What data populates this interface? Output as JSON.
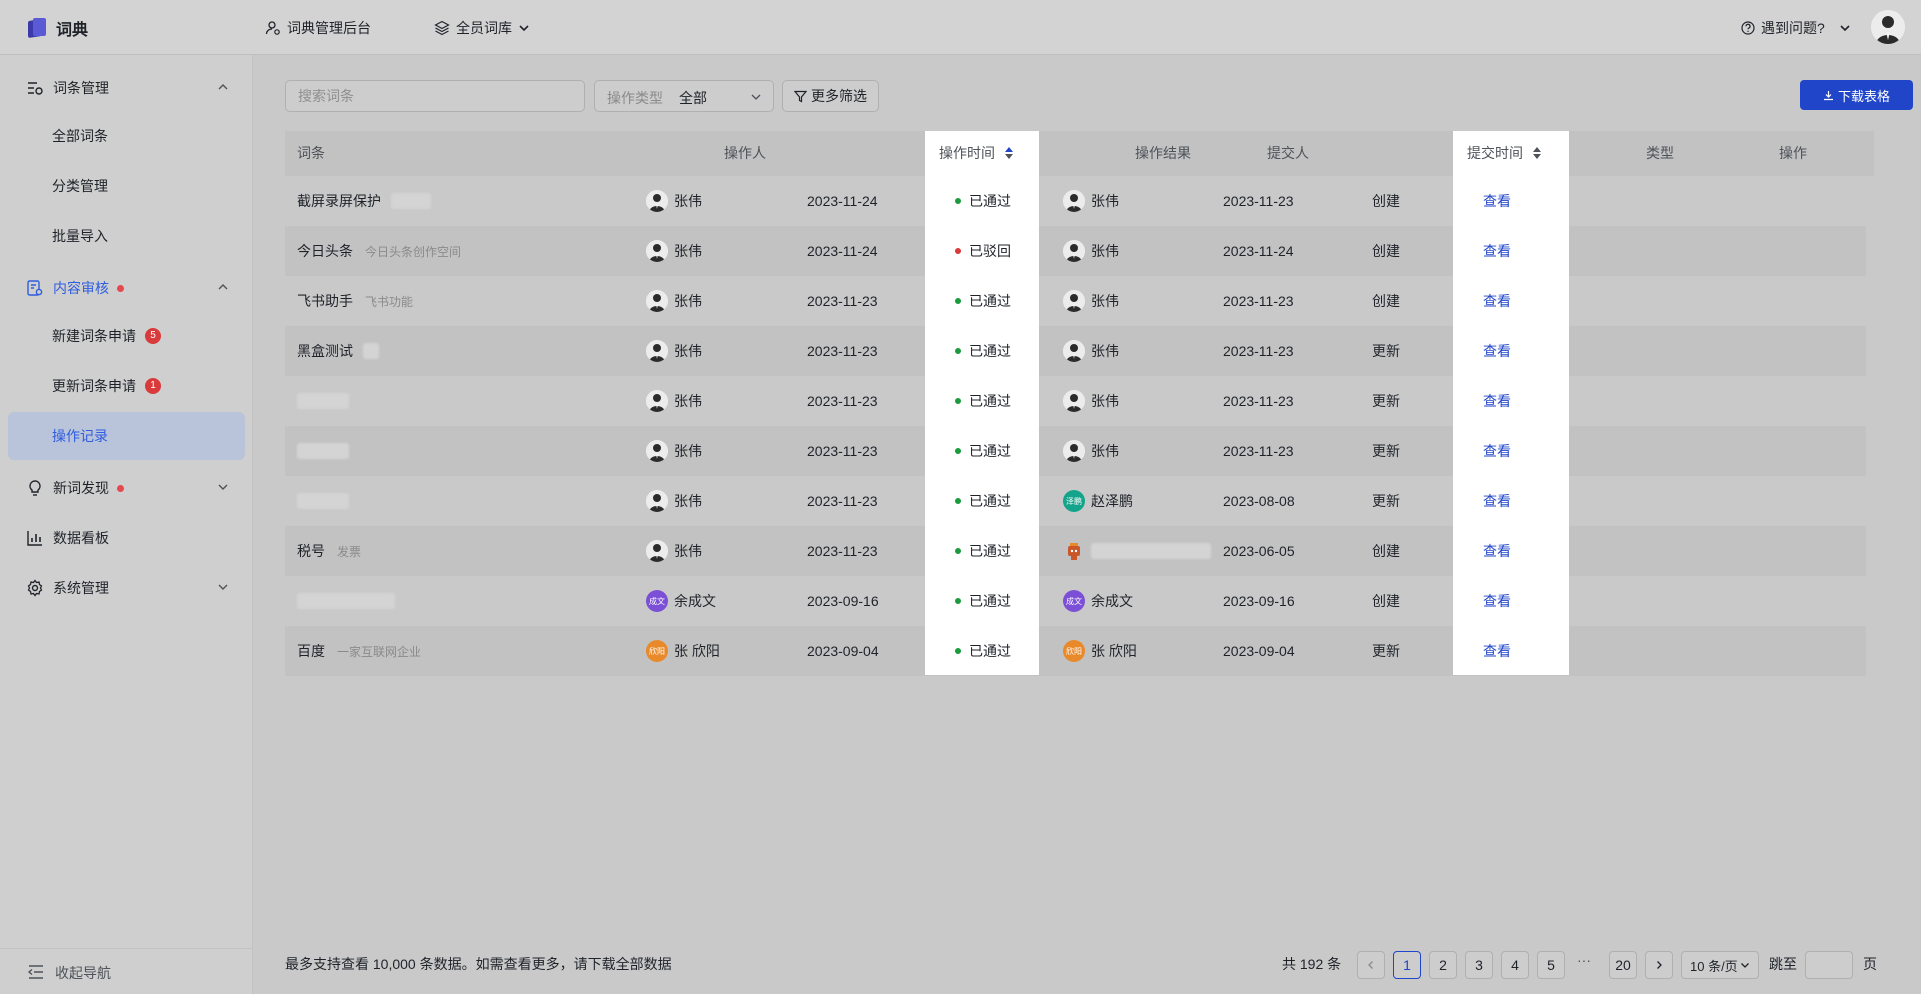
{
  "header": {
    "logo_text": "词典",
    "admin_label": "词典管理后台",
    "library_label": "全员词库",
    "help_label": "遇到问题?"
  },
  "sidebar": {
    "groups": [
      {
        "label": "词条管理",
        "icon": "list-settings-icon",
        "children": [
          "全部词条",
          "分类管理",
          "批量导入"
        ]
      },
      {
        "label": "内容审核",
        "icon": "audit-doc-icon",
        "children": [
          "新建词条申请",
          "更新词条申请",
          "操作记录"
        ]
      },
      {
        "label": "新词发现",
        "icon": "bulb-icon"
      },
      {
        "label": "数据看板",
        "icon": "bar-chart-icon"
      },
      {
        "label": "系统管理",
        "icon": "gear-icon"
      }
    ],
    "badges": {
      "new_apply": "5",
      "update_apply": "1"
    },
    "collapse_label": "收起导航"
  },
  "toolbar": {
    "search_placeholder": "搜索词条",
    "op_type_label": "操作类型",
    "op_type_value": "全部",
    "more_filter_label": "更多筛选",
    "download_label": "下载表格"
  },
  "table": {
    "columns": [
      "词条",
      "操作人",
      "操作时间",
      "操作结果",
      "提交人",
      "提交时间",
      "类型",
      "操作"
    ],
    "rows": [
      {
        "term": "截屏录屏保护",
        "desc": "",
        "operator": "张伟",
        "op_time": "2023-11-24",
        "result": "已通过",
        "submitter": "张伟",
        "sub_time": "2023-11-23",
        "type": "创建",
        "action": "查看"
      },
      {
        "term": "今日头条",
        "desc": "今日头条创作空间",
        "operator": "张伟",
        "op_time": "2023-11-24",
        "result": "已驳回",
        "submitter": "张伟",
        "sub_time": "2023-11-24",
        "type": "创建",
        "action": "查看"
      },
      {
        "term": "飞书助手",
        "desc": "飞书功能",
        "operator": "张伟",
        "op_time": "2023-11-23",
        "result": "已通过",
        "submitter": "张伟",
        "sub_time": "2023-11-23",
        "type": "创建",
        "action": "查看"
      },
      {
        "term": "黑盒测试",
        "desc": "",
        "operator": "张伟",
        "op_time": "2023-11-23",
        "result": "已通过",
        "submitter": "张伟",
        "sub_time": "2023-11-23",
        "type": "更新",
        "action": "查看"
      },
      {
        "term": "",
        "desc": "",
        "operator": "张伟",
        "op_time": "2023-11-23",
        "result": "已通过",
        "submitter": "张伟",
        "sub_time": "2023-11-23",
        "type": "更新",
        "action": "查看"
      },
      {
        "term": "",
        "desc": "",
        "operator": "张伟",
        "op_time": "2023-11-23",
        "result": "已通过",
        "submitter": "张伟",
        "sub_time": "2023-11-23",
        "type": "更新",
        "action": "查看"
      },
      {
        "term": "",
        "desc": "",
        "operator": "张伟",
        "op_time": "2023-11-23",
        "result": "已通过",
        "submitter": "赵泽鹏",
        "submitter_avatar_text": "泽鹏",
        "sub_time": "2023-08-08",
        "type": "更新",
        "action": "查看"
      },
      {
        "term": "税号",
        "desc": "发票",
        "operator": "张伟",
        "op_time": "2023-11-23",
        "result": "已通过",
        "submitter": "",
        "sub_time": "2023-06-05",
        "type": "创建",
        "action": "查看"
      },
      {
        "term": "",
        "desc": "",
        "operator": "余成文",
        "operator_avatar_text": "成文",
        "op_time": "2023-09-16",
        "result": "已通过",
        "submitter": "余成文",
        "submitter_avatar_text": "成文",
        "sub_time": "2023-09-16",
        "type": "创建",
        "action": "查看"
      },
      {
        "term": "百度",
        "desc": "一家互联网企业",
        "operator": "张 欣阳",
        "operator_avatar_text": "欣阳",
        "op_time": "2023-09-04",
        "result": "已通过",
        "submitter": "张 欣阳",
        "submitter_avatar_text": "欣阳",
        "sub_time": "2023-09-04",
        "type": "更新",
        "action": "查看"
      }
    ]
  },
  "footer": {
    "note": "最多支持查看 10,000 条数据。如需查看更多，请下载全部数据",
    "total": "共 192 条",
    "pages": [
      "1",
      "2",
      "3",
      "4",
      "5"
    ],
    "ellipsis": "···",
    "last_page": "20",
    "page_size": "10 条/页",
    "jump_label": "跳至",
    "page_unit": "页"
  },
  "colors": {
    "accent": "#2045c8",
    "status_pass": "#1a9b3c",
    "status_reject": "#d93b3b",
    "avatar_teal": "#14a38b",
    "avatar_purple": "#7b4fd6",
    "avatar_orange": "#e8892a"
  }
}
